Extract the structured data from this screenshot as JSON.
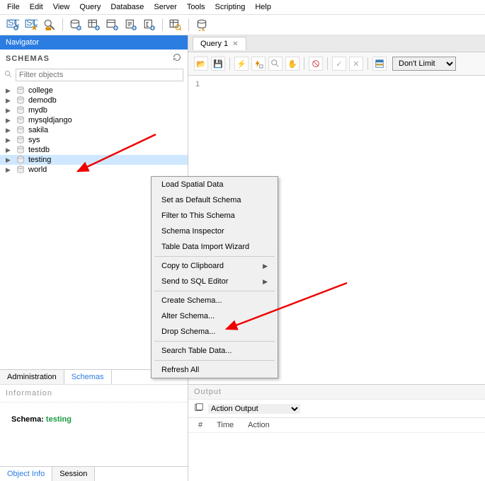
{
  "menubar": [
    "File",
    "Edit",
    "View",
    "Query",
    "Database",
    "Server",
    "Tools",
    "Scripting",
    "Help"
  ],
  "navigator": {
    "title": "Navigator"
  },
  "schemas": {
    "header": "SCHEMAS",
    "search_placeholder": "Filter objects",
    "items": [
      {
        "name": "college"
      },
      {
        "name": "demodb"
      },
      {
        "name": "mydb"
      },
      {
        "name": "mysqldjango"
      },
      {
        "name": "sakila"
      },
      {
        "name": "sys"
      },
      {
        "name": "testdb"
      },
      {
        "name": "testing",
        "selected": true
      },
      {
        "name": "world"
      }
    ]
  },
  "left_tabs": {
    "administration": "Administration",
    "schemas": "Schemas"
  },
  "info": {
    "header": "Information",
    "label": "Schema:",
    "value": "testing"
  },
  "bottom_tabs": {
    "object_info": "Object Info",
    "session": "Session"
  },
  "query": {
    "tab": "Query 1",
    "limit": "Don't Limit",
    "line": "1"
  },
  "output": {
    "header": "Output",
    "dropdown": "Action Output",
    "cols": [
      "#",
      "Time",
      "Action"
    ]
  },
  "context_menu": {
    "g1": [
      "Load Spatial Data",
      "Set as Default Schema",
      "Filter to This Schema",
      "Schema Inspector",
      "Table Data Import Wizard"
    ],
    "g2": [
      {
        "t": "Copy to Clipboard",
        "sub": true
      },
      {
        "t": "Send to SQL Editor",
        "sub": true
      }
    ],
    "g3": [
      "Create Schema...",
      "Alter Schema...",
      "Drop Schema..."
    ],
    "g4": [
      "Search Table Data..."
    ],
    "g5": [
      "Refresh All"
    ]
  }
}
